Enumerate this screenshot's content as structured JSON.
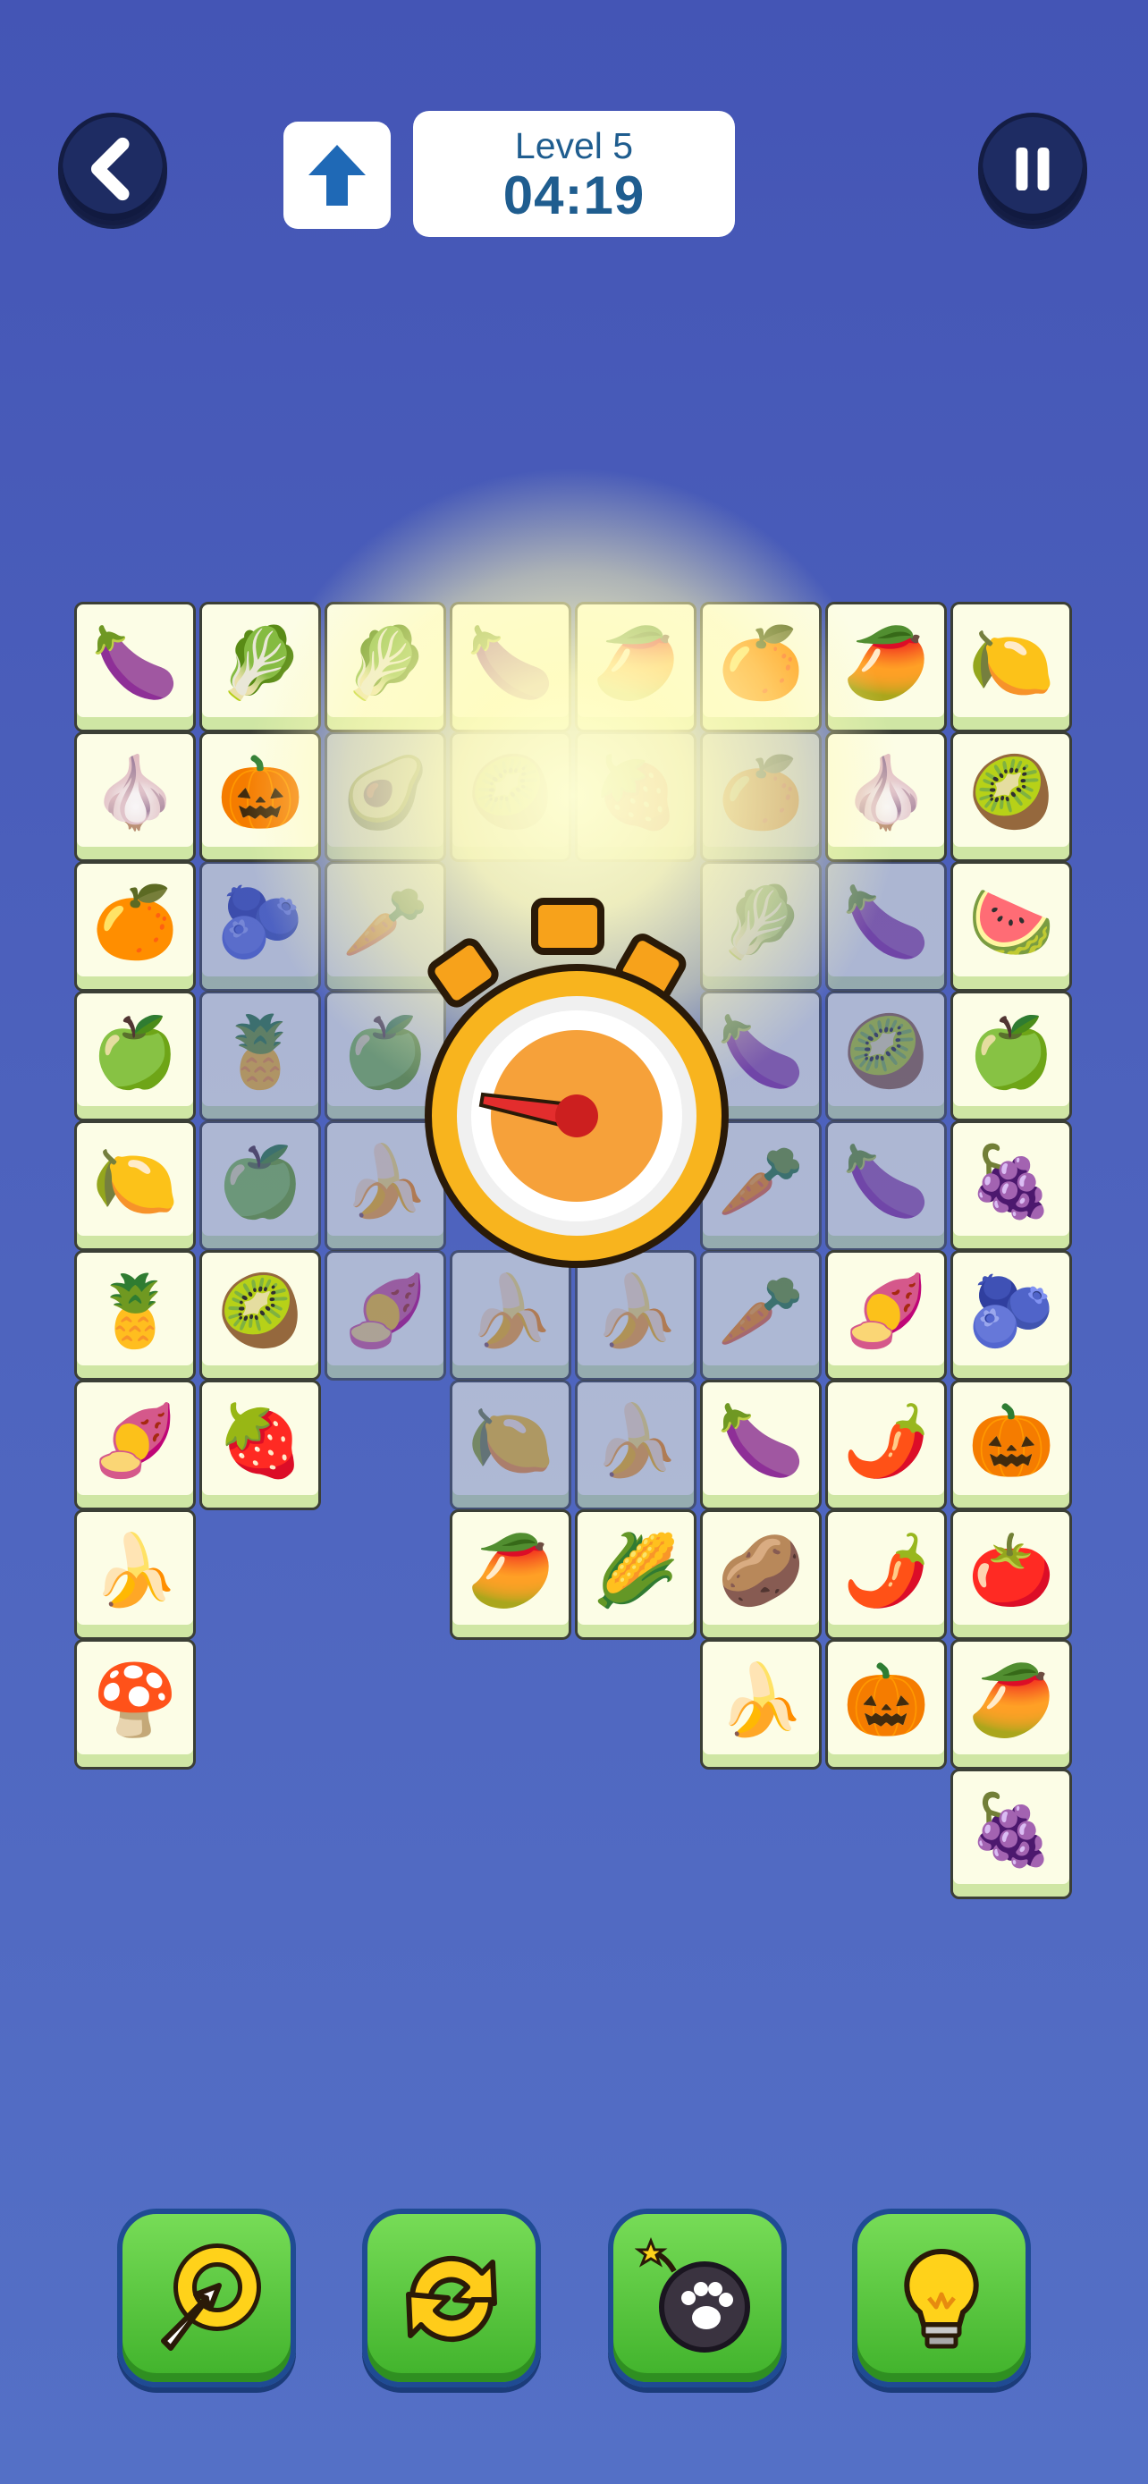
{
  "header": {
    "back_icon": "chevron-left-icon",
    "up_icon": "arrow-up-icon",
    "level_label": "Level 5",
    "timer": "04:19",
    "pause_icon": "pause-icon"
  },
  "center_icon": "stopwatch-icon",
  "board": {
    "tiles": [
      {
        "row": 0,
        "col": 0,
        "item": "eggplant",
        "icon": "🍆",
        "dim": false
      },
      {
        "row": 0,
        "col": 1,
        "item": "bok-choy",
        "icon": "🥬",
        "dim": false
      },
      {
        "row": 0,
        "col": 2,
        "item": "bok-choy",
        "icon": "🥬",
        "dim": false
      },
      {
        "row": 0,
        "col": 3,
        "item": "eggplant",
        "icon": "🍆",
        "dim": false
      },
      {
        "row": 0,
        "col": 4,
        "item": "mango",
        "icon": "🥭",
        "dim": false
      },
      {
        "row": 0,
        "col": 5,
        "item": "orange",
        "icon": "🍊",
        "dim": false
      },
      {
        "row": 0,
        "col": 6,
        "item": "mango",
        "icon": "🥭",
        "dim": false
      },
      {
        "row": 0,
        "col": 7,
        "item": "lemon",
        "icon": "🍋",
        "dim": false
      },
      {
        "row": 1,
        "col": 0,
        "item": "garlic",
        "icon": "🧄",
        "dim": false
      },
      {
        "row": 1,
        "col": 1,
        "item": "pumpkin",
        "icon": "🎃",
        "dim": false
      },
      {
        "row": 1,
        "col": 2,
        "item": "avocado",
        "icon": "🥑",
        "dim": true
      },
      {
        "row": 1,
        "col": 3,
        "item": "kiwi",
        "icon": "🥝",
        "dim": true
      },
      {
        "row": 1,
        "col": 4,
        "item": "strawberry",
        "icon": "🍓",
        "dim": true
      },
      {
        "row": 1,
        "col": 5,
        "item": "orange",
        "icon": "🍊",
        "dim": true
      },
      {
        "row": 1,
        "col": 6,
        "item": "garlic",
        "icon": "🧄",
        "dim": false
      },
      {
        "row": 1,
        "col": 7,
        "item": "kiwi",
        "icon": "🥝",
        "dim": false
      },
      {
        "row": 2,
        "col": 0,
        "item": "orange",
        "icon": "🍊",
        "dim": false
      },
      {
        "row": 2,
        "col": 1,
        "item": "blueberry",
        "icon": "🫐",
        "dim": true
      },
      {
        "row": 2,
        "col": 2,
        "item": "carrot",
        "icon": "🥕",
        "dim": true
      },
      {
        "row": 2,
        "col": 5,
        "item": "bok-choy",
        "icon": "🥬",
        "dim": true
      },
      {
        "row": 2,
        "col": 6,
        "item": "eggplant",
        "icon": "🍆",
        "dim": true
      },
      {
        "row": 2,
        "col": 7,
        "item": "watermelon",
        "icon": "🍉",
        "dim": false
      },
      {
        "row": 3,
        "col": 0,
        "item": "apple",
        "icon": "🍏",
        "dim": false
      },
      {
        "row": 3,
        "col": 1,
        "item": "pineapple",
        "icon": "🍍",
        "dim": true
      },
      {
        "row": 3,
        "col": 2,
        "item": "apple",
        "icon": "🍏",
        "dim": true
      },
      {
        "row": 3,
        "col": 5,
        "item": "eggplant",
        "icon": "🍆",
        "dim": true
      },
      {
        "row": 3,
        "col": 6,
        "item": "kiwi",
        "icon": "🥝",
        "dim": true
      },
      {
        "row": 3,
        "col": 7,
        "item": "apple",
        "icon": "🍏",
        "dim": false
      },
      {
        "row": 4,
        "col": 0,
        "item": "lemon",
        "icon": "🍋",
        "dim": false
      },
      {
        "row": 4,
        "col": 1,
        "item": "apple",
        "icon": "🍏",
        "dim": true
      },
      {
        "row": 4,
        "col": 2,
        "item": "banana",
        "icon": "🍌",
        "dim": true
      },
      {
        "row": 4,
        "col": 5,
        "item": "carrot",
        "icon": "🥕",
        "dim": true
      },
      {
        "row": 4,
        "col": 6,
        "item": "eggplant",
        "icon": "🍆",
        "dim": true
      },
      {
        "row": 4,
        "col": 7,
        "item": "grapes",
        "icon": "🍇",
        "dim": false
      },
      {
        "row": 5,
        "col": 0,
        "item": "pineapple",
        "icon": "🍍",
        "dim": false
      },
      {
        "row": 5,
        "col": 1,
        "item": "kiwi",
        "icon": "🥝",
        "dim": false
      },
      {
        "row": 5,
        "col": 2,
        "item": "lotus-root",
        "icon": "🍠",
        "dim": true
      },
      {
        "row": 5,
        "col": 3,
        "item": "banana",
        "icon": "🍌",
        "dim": true
      },
      {
        "row": 5,
        "col": 4,
        "item": "banana",
        "icon": "🍌",
        "dim": true
      },
      {
        "row": 5,
        "col": 5,
        "item": "carrot",
        "icon": "🥕",
        "dim": true
      },
      {
        "row": 5,
        "col": 6,
        "item": "lotus-root",
        "icon": "🍠",
        "dim": false
      },
      {
        "row": 5,
        "col": 7,
        "item": "blueberry",
        "icon": "🫐",
        "dim": false
      },
      {
        "row": 6,
        "col": 0,
        "item": "lotus-root",
        "icon": "🍠",
        "dim": false
      },
      {
        "row": 6,
        "col": 1,
        "item": "strawberry",
        "icon": "🍓",
        "dim": false
      },
      {
        "row": 6,
        "col": 3,
        "item": "lemon",
        "icon": "🍋",
        "dim": true
      },
      {
        "row": 6,
        "col": 4,
        "item": "banana",
        "icon": "🍌",
        "dim": true
      },
      {
        "row": 6,
        "col": 5,
        "item": "eggplant",
        "icon": "🍆",
        "dim": false
      },
      {
        "row": 6,
        "col": 6,
        "item": "chili",
        "icon": "🌶️",
        "dim": false
      },
      {
        "row": 6,
        "col": 7,
        "item": "pumpkin",
        "icon": "🎃",
        "dim": false
      },
      {
        "row": 7,
        "col": 0,
        "item": "banana",
        "icon": "🍌",
        "dim": false
      },
      {
        "row": 7,
        "col": 3,
        "item": "mango",
        "icon": "🥭",
        "dim": false
      },
      {
        "row": 7,
        "col": 4,
        "item": "corn",
        "icon": "🌽",
        "dim": false
      },
      {
        "row": 7,
        "col": 5,
        "item": "potato",
        "icon": "🥔",
        "dim": false
      },
      {
        "row": 7,
        "col": 6,
        "item": "chili",
        "icon": "🌶️",
        "dim": false
      },
      {
        "row": 7,
        "col": 7,
        "item": "tomato",
        "icon": "🍅",
        "dim": false
      },
      {
        "row": 8,
        "col": 0,
        "item": "mushroom",
        "icon": "🍄",
        "dim": false
      },
      {
        "row": 8,
        "col": 5,
        "item": "banana",
        "icon": "🍌",
        "dim": false
      },
      {
        "row": 8,
        "col": 6,
        "item": "pumpkin",
        "icon": "🎃",
        "dim": false
      },
      {
        "row": 8,
        "col": 7,
        "item": "mango",
        "icon": "🥭",
        "dim": false
      },
      {
        "row": 9,
        "col": 7,
        "item": "grapes",
        "icon": "🍇",
        "dim": false
      }
    ]
  },
  "toolbar": {
    "buttons": [
      {
        "name": "magnet-tool",
        "icon": "pointer-ring-icon"
      },
      {
        "name": "shuffle-tool",
        "icon": "refresh-arrows-icon"
      },
      {
        "name": "bomb-tool",
        "icon": "bomb-icon"
      },
      {
        "name": "hint-tool",
        "icon": "lightbulb-icon"
      }
    ]
  },
  "colors": {
    "background": "#4a5fbd",
    "tile_face": "#fcfde6",
    "tile_base": "#cfe6a4",
    "button_green": "#4bbf32",
    "stopwatch_orange": "#f7a21b"
  }
}
